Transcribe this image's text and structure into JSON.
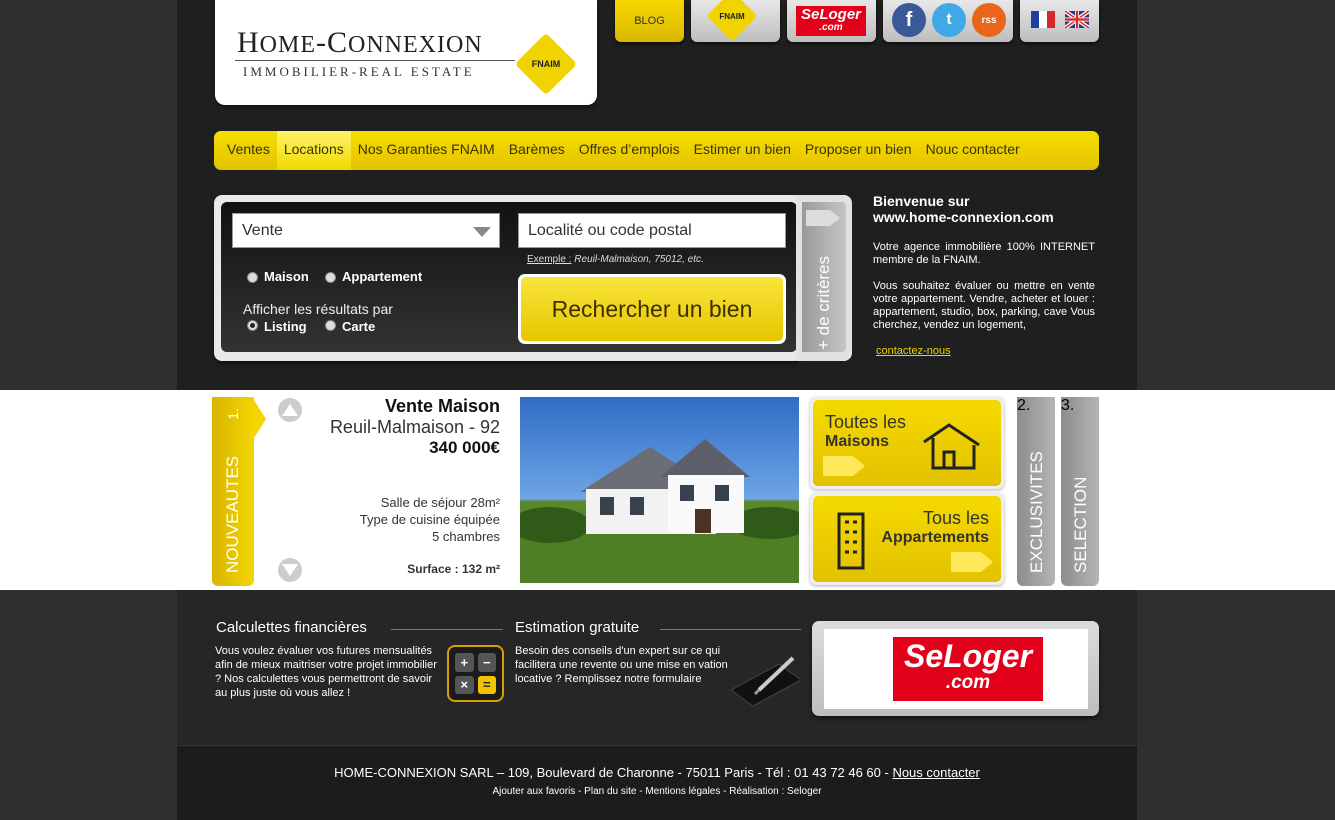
{
  "brand": {
    "title": "Home-Connexion",
    "subtitle": "Immobilier-Real Estate",
    "fnaim": "FNAIM"
  },
  "top_links": {
    "blog": "BLOG",
    "fnaim": "FNAIM",
    "seloger": "SeLoger",
    ".com": ".com"
  },
  "social": {
    "facebook": "f",
    "twitter": "t",
    "rss": "rss"
  },
  "nav": {
    "items": [
      "Ventes",
      "Locations",
      "Nos Garanties FNAIM",
      "Barèmes",
      "Offres d’emplois",
      "Estimer un bien",
      "Proposer un bien",
      "Nouc contacter"
    ],
    "active": "Locations"
  },
  "search": {
    "type_value": "Vente",
    "location_placeholder": "Localité ou code postal",
    "example_label": "Exemple :",
    "example_text": " Reuil-Malmaison, 75012, etc.",
    "radio_maison": "Maison",
    "radio_appartement": "Appartement",
    "afficher": "Afficher les résultats par",
    "radio_listing": "Listing",
    "radio_carte": "Carte",
    "button": "Rechercher un bien",
    "criteres": "+ de critères"
  },
  "welcome": {
    "title_line1": "Bienvenue sur",
    "title_line2": "www.home-connexion.com",
    "p1": "Votre agence immobilière 100% INTERNET membre de la FNAIM.",
    "p2": "Vous souhaitez évaluer ou mettre en vente votre appartement. Vendre, acheter et louer : appartement, studio, box, parking, cave Vous cherchez, vendez un logement,",
    "link": "contactez-nous"
  },
  "featured": {
    "tab": "NOUVEAUTES",
    "tab_num": "1.",
    "title": "Vente Maison",
    "location": "Reuil-Malmaison - 92",
    "price": "340 000€",
    "details": [
      "Salle de séjour 28m²",
      "Type de cuisine équipée",
      "5 chambres"
    ],
    "surface": "Surface : 132 m²"
  },
  "categories": {
    "maisons_l1": "Toutes les",
    "maisons_l2": "Maisons",
    "appart_l1": "Tous les",
    "appart_l2": "Appartements"
  },
  "side_tabs": {
    "exclusivites": "EXCLUSIVITES",
    "exclusivites_num": "2.",
    "selection": "SELECTION",
    "selection_num": "3."
  },
  "bottom": {
    "calc_title": "Calculettes financières",
    "calc_text": "Vous voulez évaluer vos futures mensualités afin de mieux maitriser votre projet immobilier ? Nos calculettes vous permettront de savoir au plus juste où vous allez !",
    "calc_keys": [
      "+",
      "−",
      "×",
      "="
    ],
    "estim_title": "Estimation gratuite",
    "estim_text": "Besoin des conseils d'un expert sur ce qui facilitera une revente ou une mise en vation locative ? Remplissez notre formulaire",
    "seloger": "SeLoger",
    "seloger_com": ".com"
  },
  "footer": {
    "address": "HOME-CONNEXION SARL – 109, Boulevard de Charonne - 75011 Paris  - Tél : 01 43 72 46 60 - ",
    "contact": "Nous contacter",
    "links": "Ajouter aux favoris - Plan du site - Mentions légales - Réalisation : Seloger"
  },
  "colors": {
    "accent": "#f2d500",
    "dark": "#1f1f1f",
    "seloger": "#e2001a"
  }
}
